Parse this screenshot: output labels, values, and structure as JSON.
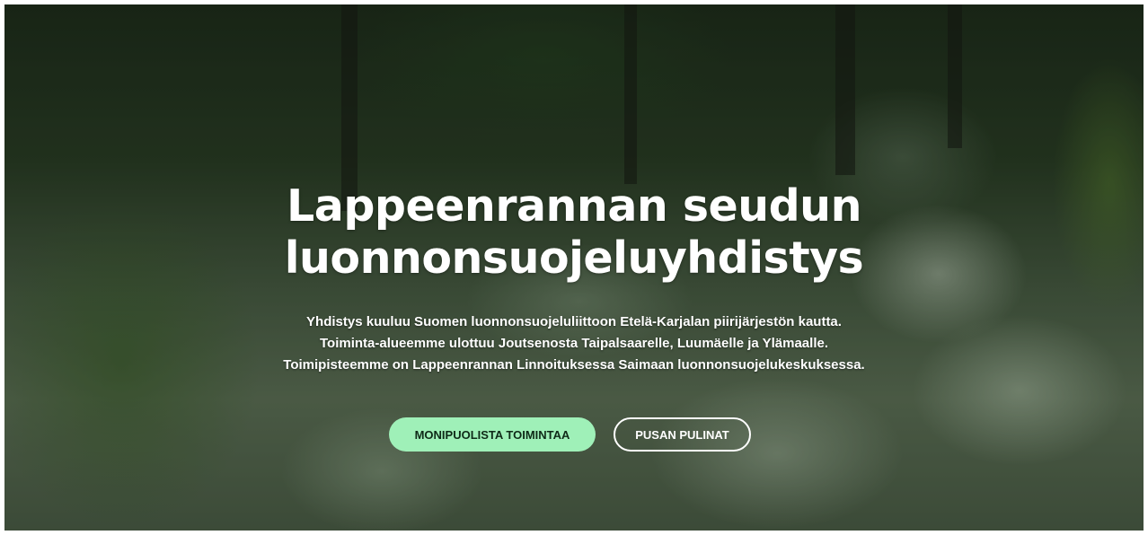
{
  "hero": {
    "title_line1": "Lappeenrannan seudun",
    "title_line2": "luonnonsuojeluyhdistys",
    "description": [
      "Yhdistys kuuluu Suomen luonnonsuojeluliittoon Etelä-Karjalan piirijärjestön kautta.",
      "Toiminta-alueemme ulottuu Joutsenosta Taipalsaarelle, Luumäelle ja Ylämaalle.",
      "Toimipisteemme on Lappeenrannan Linnoituksessa Saimaan luonnonsuojelukeskuksessa."
    ],
    "primary_button": "MONIPUOLISTA TOIMINTAA",
    "secondary_button": "PUSAN PULINAT"
  },
  "colors": {
    "primary_button_bg": "#9ff0b8",
    "text": "#ffffff"
  }
}
